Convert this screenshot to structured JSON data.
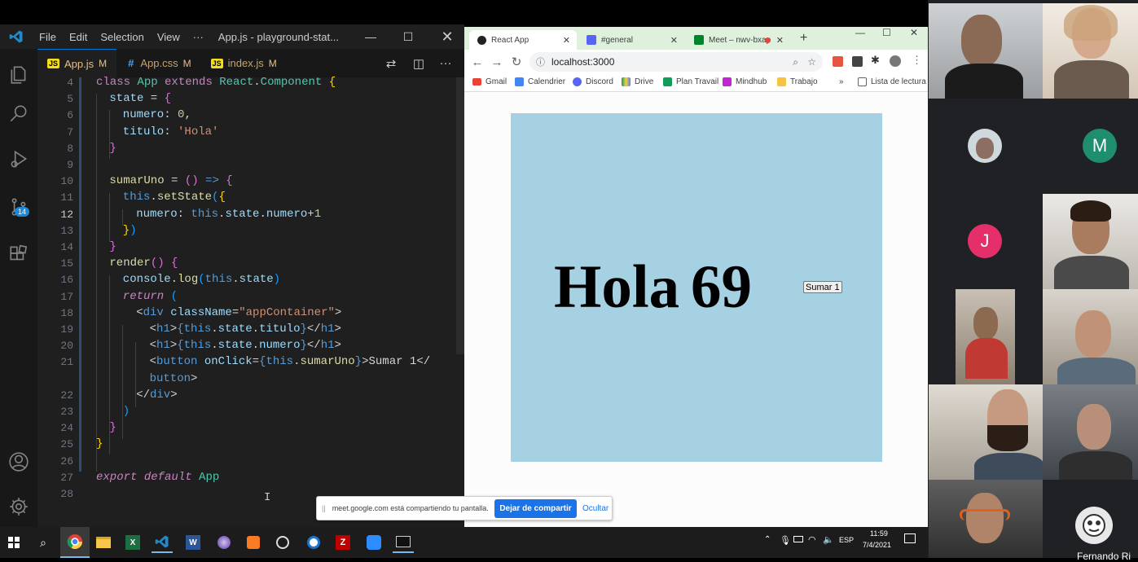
{
  "vscode": {
    "menu": [
      "File",
      "Edit",
      "Selection",
      "View",
      "···"
    ],
    "title": "App.js - playground-stat...",
    "tabs": [
      {
        "name": "App.js",
        "type": "JS",
        "status": "M"
      },
      {
        "name": "App.css",
        "type": "#",
        "status": "M"
      },
      {
        "name": "index.js",
        "type": "JS",
        "status": "M"
      }
    ],
    "badge_count": "14",
    "line_numbers": [
      "4",
      "5",
      "6",
      "7",
      "8",
      "9",
      "10",
      "11",
      "12",
      "13",
      "14",
      "15",
      "16",
      "17",
      "18",
      "19",
      "20",
      "21",
      "",
      "22",
      "23",
      "24",
      "25",
      "26",
      "27",
      "28"
    ],
    "code": {
      "l4": [
        "class",
        " App ",
        "extends",
        " React",
        ".",
        "Component",
        " {"
      ],
      "l5": [
        "state",
        " = ",
        "{"
      ],
      "l6": [
        "numero",
        ": ",
        "0",
        ","
      ],
      "l7": [
        "titulo",
        ": ",
        "'Hola'"
      ],
      "l8": [
        "}"
      ],
      "l10": [
        "sumarUno",
        " = ",
        "()",
        " => ",
        "{"
      ],
      "l11": [
        "this",
        ".",
        "setState",
        "(",
        "{"
      ],
      "l12": [
        "numero",
        ": ",
        "this",
        ".",
        "state",
        ".",
        "numero",
        "+",
        "1"
      ],
      "l13": [
        "}",
        ")"
      ],
      "l14": [
        "}"
      ],
      "l15": [
        "render",
        "() ",
        "{"
      ],
      "l16": [
        "console",
        ".",
        "log",
        "(",
        "this",
        ".",
        "state",
        ")"
      ],
      "l17": [
        "return",
        " ("
      ],
      "l18": [
        "<",
        "div",
        " ",
        "className",
        "=",
        "\"appContainer\"",
        ">"
      ],
      "l19": [
        "<",
        "h1",
        ">",
        "{",
        "this",
        ".",
        "state",
        ".",
        "titulo",
        "}",
        "</",
        "h1",
        ">"
      ],
      "l20": [
        "<",
        "h1",
        ">",
        "{",
        "this",
        ".",
        "state",
        ".",
        "numero",
        "}",
        "</",
        "h1",
        ">"
      ],
      "l21": [
        "<",
        "button",
        " ",
        "onClick",
        "=",
        "{",
        "this",
        ".",
        "sumarUno",
        "}",
        ">",
        "Sumar 1",
        "</"
      ],
      "l21b": [
        "button",
        ">"
      ],
      "l22": [
        "</",
        "div",
        ">"
      ],
      "l23": [
        ")"
      ],
      "l24": [
        "}"
      ],
      "l25": [
        "}"
      ],
      "l27": [
        "export",
        " ",
        "default",
        " ",
        "App"
      ]
    }
  },
  "chrome": {
    "tabs": [
      "React App",
      "#general",
      "Meet – nwv-bxap"
    ],
    "url": "localhost:3000",
    "bookmarks": [
      "Gmail",
      "Calendrier",
      "Discord",
      "Drive",
      "Plan Travail",
      "Mindhub",
      "Trabajo",
      "»",
      "Lista de lectura"
    ],
    "page": {
      "titulo": "Hola",
      "numero": "69",
      "button": "Sumar 1"
    }
  },
  "sharebar": {
    "text": "meet.google.com está compartiendo tu pantalla.",
    "stop": "Dejar de compartir",
    "hide": "Ocultar"
  },
  "meet": {
    "avatars": [
      "M",
      "J"
    ],
    "bottom_name": "Fernando Ri"
  },
  "taskbar": {
    "lang": "ESP",
    "time": "11:59",
    "date": "7/4/2021"
  },
  "colors": {
    "vscode_bg": "#1e1e1e",
    "page_container": "#a6d1e3",
    "accent_blue": "#1a73e8"
  }
}
